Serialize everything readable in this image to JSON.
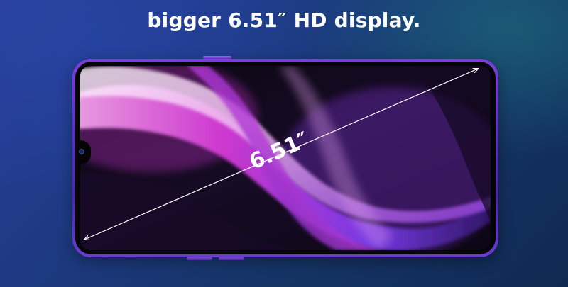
{
  "headline": "bigger 6.51″ HD display.",
  "diagonal_label": "6.51″",
  "colors": {
    "background_deep": "#163569",
    "phone_frame": "#6a3cd0",
    "wallpaper_magenta": "#d02fd8",
    "wallpaper_violet": "#7a3ae8",
    "text": "#ffffff"
  }
}
